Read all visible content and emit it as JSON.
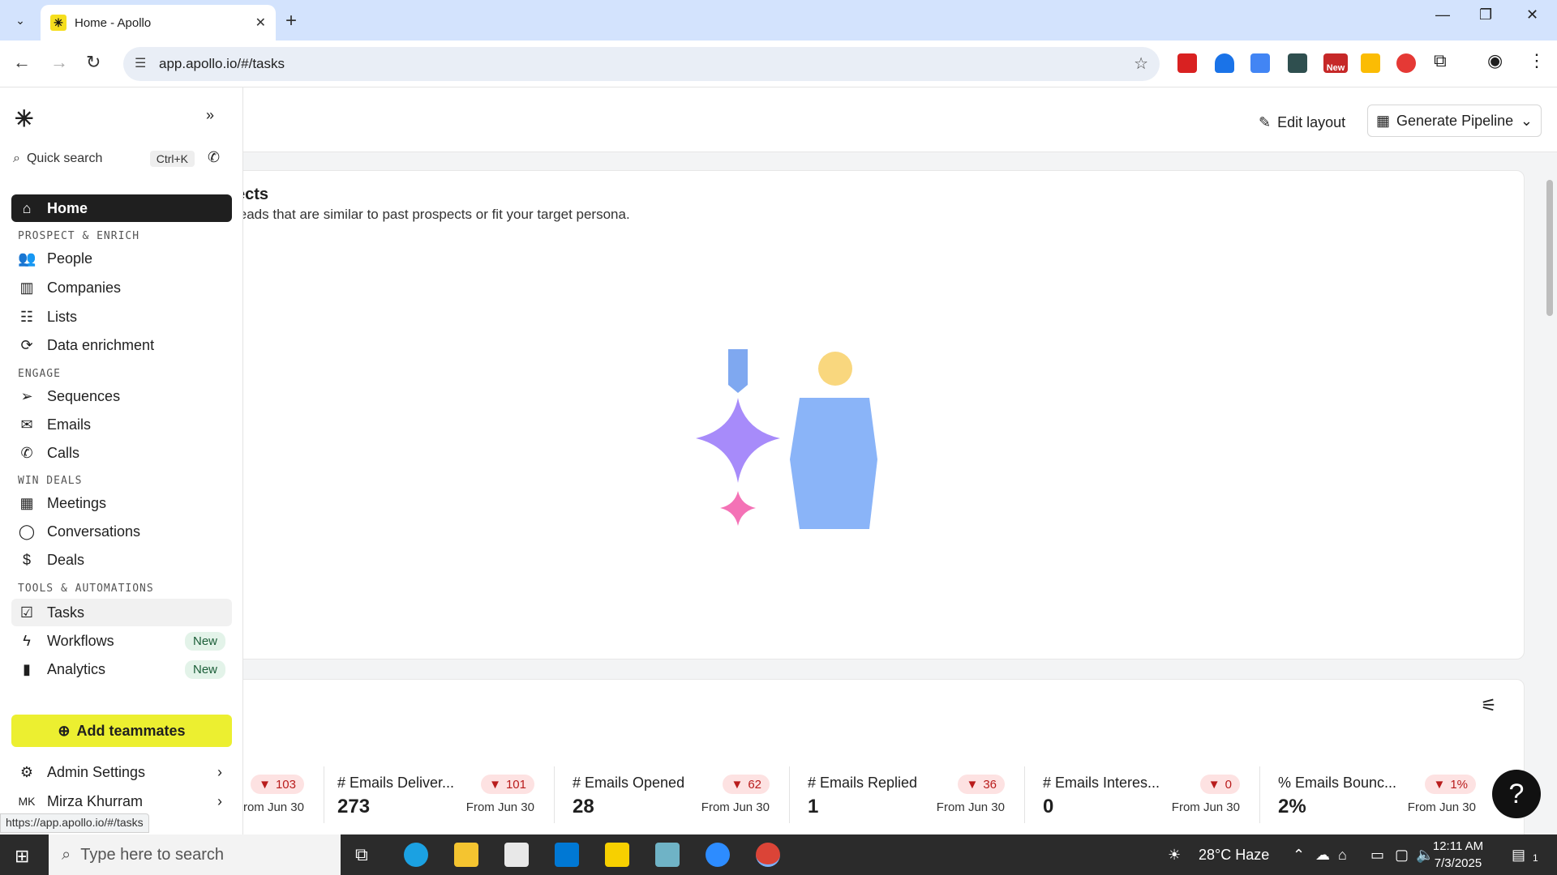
{
  "browser": {
    "tab_title": "Home - Apollo",
    "url": "app.apollo.io/#/tasks",
    "status_url": "https://app.apollo.io/#/tasks",
    "ext_new_label": "New"
  },
  "sidebar": {
    "quick_search": "Quick search",
    "quick_search_shortcut": "Ctrl+K",
    "home": "Home",
    "section_prospect": "PROSPECT & ENRICH",
    "people": "People",
    "companies": "Companies",
    "lists": "Lists",
    "data_enrichment": "Data enrichment",
    "section_engage": "ENGAGE",
    "sequences": "Sequences",
    "emails": "Emails",
    "calls": "Calls",
    "section_win": "WIN DEALS",
    "meetings": "Meetings",
    "conversations": "Conversations",
    "deals": "Deals",
    "section_tools": "TOOLS & AUTOMATIONS",
    "tasks": "Tasks",
    "workflows": "Workflows",
    "workflows_badge": "New",
    "analytics": "Analytics",
    "analytics_badge": "New",
    "add_teammates": "Add teammates",
    "admin_settings": "Admin Settings",
    "user_initials": "MK",
    "user_name": "Mirza Khurram"
  },
  "header": {
    "crumb_tail": ")",
    "edit_layout": "Edit layout",
    "generate_pipeline": "Generate Pipeline"
  },
  "prospects_card": {
    "title": "ects",
    "subtitle": "leads that are similar to past prospects or fit your target persona."
  },
  "metrics": [
    {
      "label": "",
      "badge": "103",
      "value": "",
      "from": "rom Jun 30"
    },
    {
      "label": "# Emails Deliver...",
      "badge": "101",
      "value": "273",
      "from": "From Jun 30"
    },
    {
      "label": "# Emails Opened",
      "badge": "62",
      "value": "28",
      "from": "From Jun 30"
    },
    {
      "label": "# Emails Replied",
      "badge": "36",
      "value": "1",
      "from": "From Jun 30"
    },
    {
      "label": "# Emails Interes...",
      "badge": "0",
      "value": "0",
      "from": "From Jun 30"
    },
    {
      "label": "% Emails Bounc...",
      "badge": "1%",
      "value": "2%",
      "from": "From Jun 30"
    }
  ],
  "taskbar": {
    "search_placeholder": "Type here to search",
    "weather": "28°C  Haze",
    "time": "12:11 AM",
    "date": "7/3/2025",
    "notif_count": "1"
  },
  "colors": {
    "accent_yellow": "#ecef30",
    "badge_red_bg": "#fde2e2",
    "badge_red_text": "#b91c1c"
  }
}
